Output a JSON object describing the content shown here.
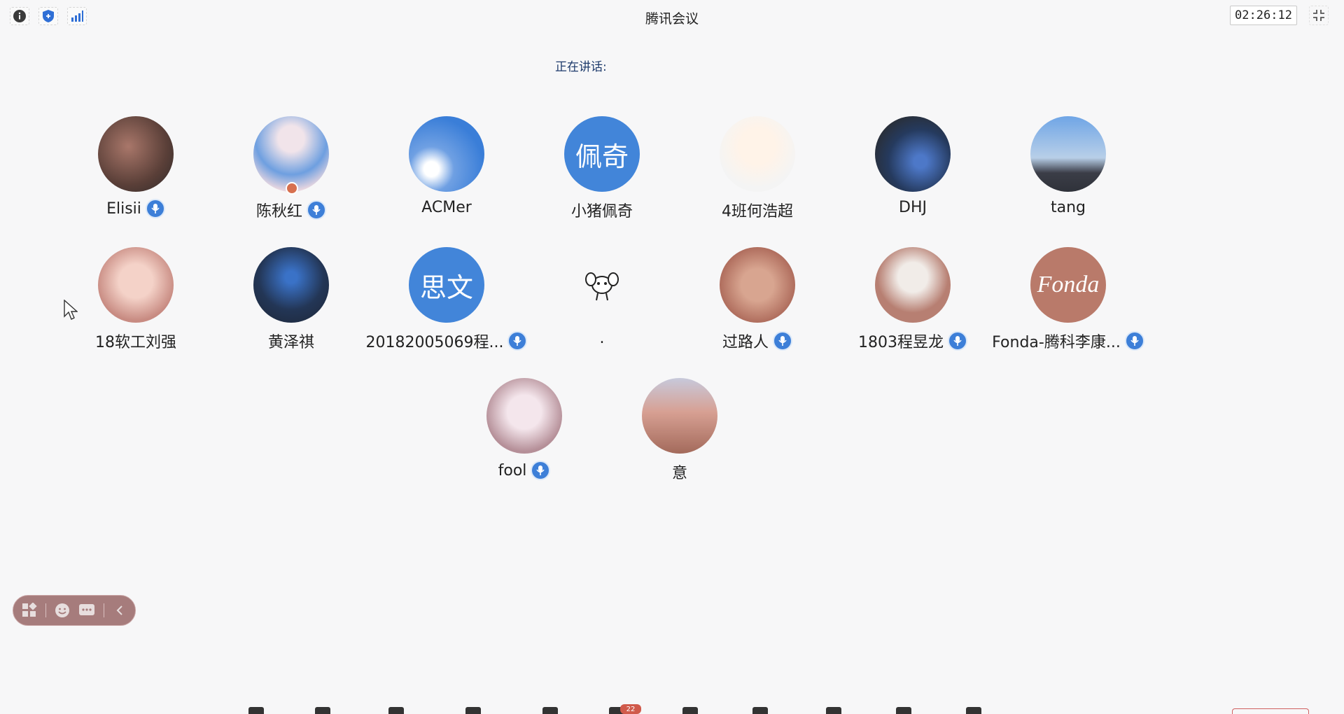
{
  "app": {
    "title": "腾讯会议",
    "timer": "02:26:12",
    "speaking_label": "正在讲话:"
  },
  "colors": {
    "accent": "#4285d9",
    "mic_badge": "#3d7fd8",
    "toolbar": "#a67c7c"
  },
  "top_icons": [
    "info-icon",
    "shield-icon",
    "signal-icon"
  ],
  "participants": [
    {
      "name": "Elisii",
      "avatar": "photo",
      "mic": true
    },
    {
      "name": "陈秋红",
      "avatar": "photo",
      "mic": true,
      "host": true
    },
    {
      "name": "ACMer",
      "avatar": "photo",
      "mic": false
    },
    {
      "name": "小猪佩奇",
      "avatar": "text",
      "avatar_text": "佩奇",
      "mic": false
    },
    {
      "name": "4班何浩超",
      "avatar": "photo",
      "mic": false
    },
    {
      "name": "DHJ",
      "avatar": "photo",
      "mic": false
    },
    {
      "name": "tang",
      "avatar": "photo",
      "mic": false
    },
    {
      "name": "18软工刘强",
      "avatar": "photo",
      "mic": false
    },
    {
      "name": "黄泽祺",
      "avatar": "photo",
      "mic": false
    },
    {
      "name": "20182005069程...",
      "avatar": "text",
      "avatar_text": "思文",
      "mic": true
    },
    {
      "name": ".",
      "avatar": "photo",
      "mic": false
    },
    {
      "name": "过路人",
      "avatar": "photo",
      "mic": true
    },
    {
      "name": "1803程昱龙",
      "avatar": "photo",
      "mic": true
    },
    {
      "name": "Fonda-腾科李康...",
      "avatar": "logo",
      "avatar_text": "Fonda",
      "mic": true
    },
    {
      "name": "fool",
      "avatar": "photo",
      "mic": true
    },
    {
      "name": "意",
      "avatar": "photo",
      "mic": false
    }
  ],
  "float_toolbar": {
    "icons": [
      "grid-icon",
      "emoji-icon",
      "chat-icon",
      "chevron-left-icon"
    ]
  },
  "bottom_toolbar": {
    "badge_count": "22"
  }
}
